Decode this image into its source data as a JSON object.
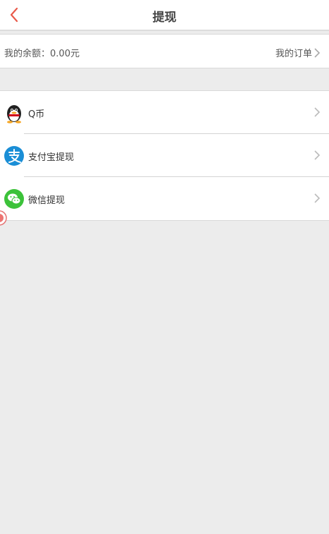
{
  "header": {
    "title": "提现",
    "back_icon": "back-arrow-icon",
    "accent_color": "#e95a4a"
  },
  "balance": {
    "label": "我的余额：",
    "value": "0.00元",
    "orders_link": "我的订单"
  },
  "menu": {
    "items": [
      {
        "label": "Q币",
        "icon": "qq-penguin-icon"
      },
      {
        "label": "支付宝提现",
        "icon": "alipay-icon"
      },
      {
        "label": "微信提现",
        "icon": "wechat-icon"
      }
    ]
  },
  "colors": {
    "background": "#ececec",
    "alipay": "#1a8ed6",
    "wechat": "#3cc23a"
  }
}
